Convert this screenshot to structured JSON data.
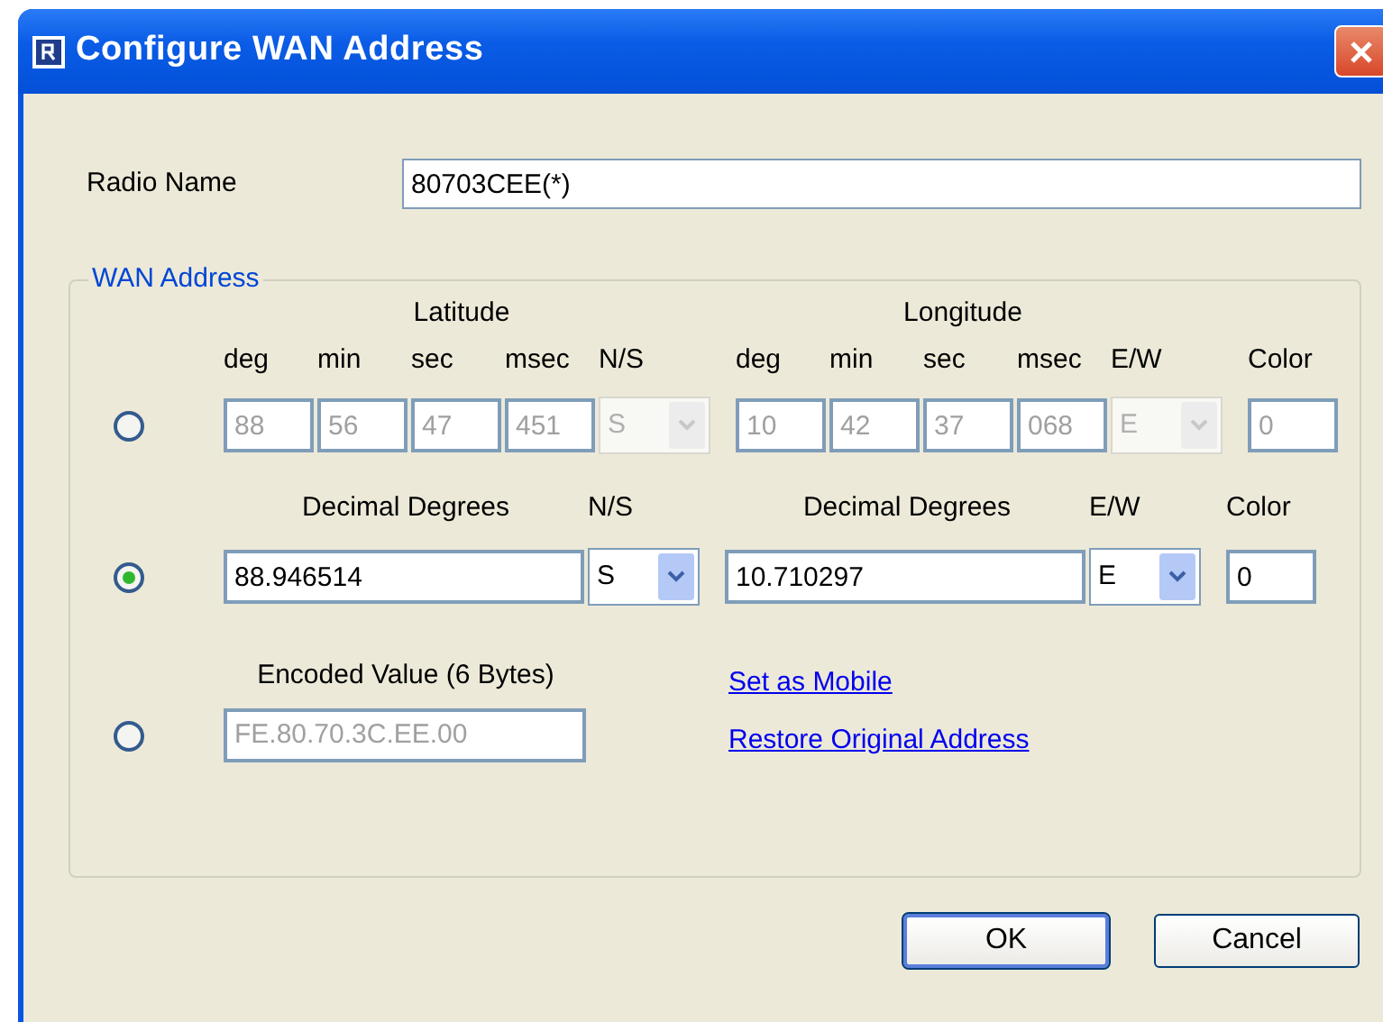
{
  "window": {
    "title": "Configure WAN Address"
  },
  "radio_name": {
    "label": "Radio Name",
    "value": "80703CEE(*)"
  },
  "wan_address": {
    "legend": "WAN Address",
    "dms": {
      "selected": false,
      "latitude": {
        "heading": "Latitude",
        "columns": [
          "deg",
          "min",
          "sec",
          "msec",
          "N/S"
        ],
        "values": [
          "88",
          "56",
          "47",
          "451"
        ],
        "hemisphere": "S"
      },
      "longitude": {
        "heading": "Longitude",
        "columns": [
          "deg",
          "min",
          "sec",
          "msec",
          "E/W"
        ],
        "values": [
          "10",
          "42",
          "37",
          "068"
        ],
        "hemisphere": "E"
      },
      "color_label": "Color",
      "color_value": "0"
    },
    "decimal": {
      "selected": true,
      "latitude": {
        "heading": "Decimal Degrees",
        "hemisphere_label": "N/S",
        "value": "88.946514",
        "hemisphere": "S"
      },
      "longitude": {
        "heading": "Decimal Degrees",
        "hemisphere_label": "E/W",
        "value": "10.710297",
        "hemisphere": "E"
      },
      "color_label": "Color",
      "color_value": "0"
    },
    "encoded": {
      "selected": false,
      "label": "Encoded Value (6 Bytes)",
      "value": "FE.80.70.3C.EE.00"
    },
    "links": [
      "Set as Mobile",
      "Restore Original Address"
    ]
  },
  "buttons": [
    {
      "label": "OK",
      "default": true
    },
    {
      "label": "Cancel",
      "default": false
    }
  ]
}
